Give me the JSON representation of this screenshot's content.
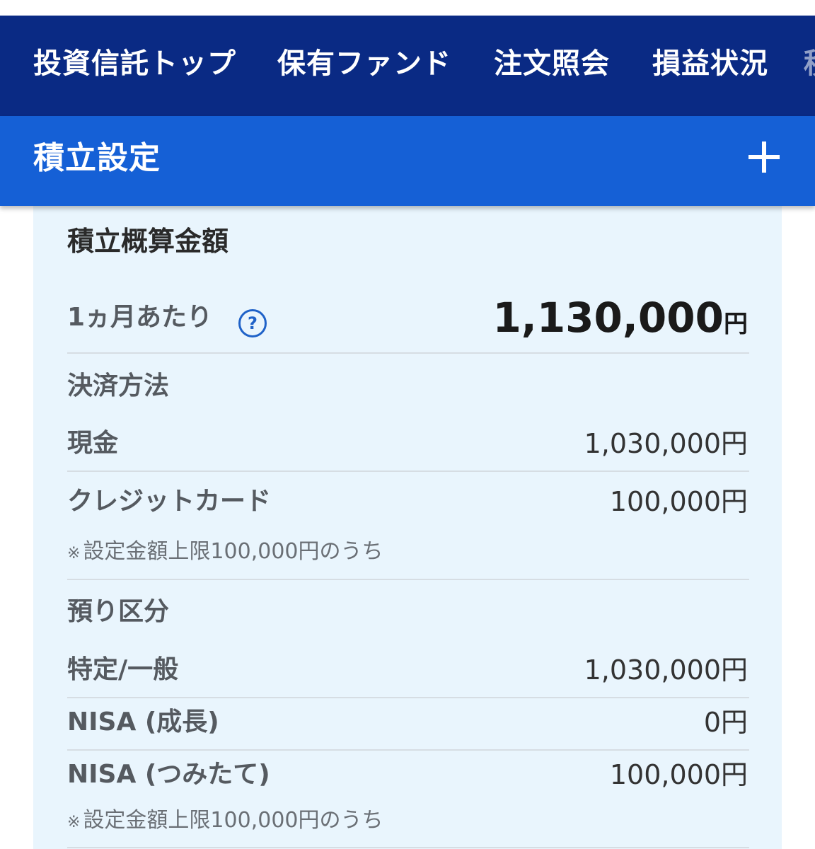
{
  "tabs": [
    "投資信託トップ",
    "保有ファンド",
    "注文照会",
    "損益状況",
    "積"
  ],
  "section": {
    "title": "積立設定",
    "expand_icon": "plus-icon"
  },
  "summary": {
    "heading": "積立概算金額",
    "monthly_label": "1ヵ月あたり",
    "monthly_value": "1,130,000",
    "monthly_unit": "円",
    "help_icon_glyph": "?"
  },
  "payment": {
    "heading": "決済方法",
    "cash_label": "現金",
    "cash_value": "1,030,000円",
    "card_label": "クレジットカード",
    "card_value": "100,000円",
    "card_note": "設定金額上限100,000円のうち"
  },
  "account": {
    "heading": "預り区分",
    "tokutei_label": "特定/一般",
    "tokutei_value": "1,030,000円",
    "nisa_growth_label": "NISA (成長)",
    "nisa_growth_value": "0円",
    "nisa_tsumitate_label": "NISA (つみたて)",
    "nisa_tsumitate_value": "100,000円",
    "nisa_note": "設定金額上限100,000円のうち"
  },
  "note_mark": "※",
  "colors": {
    "tabbar_bg": "#0a2a84",
    "header_bg": "#1560d6",
    "panel_bg": "#e9f5fd",
    "accent": "#1f62c8"
  }
}
